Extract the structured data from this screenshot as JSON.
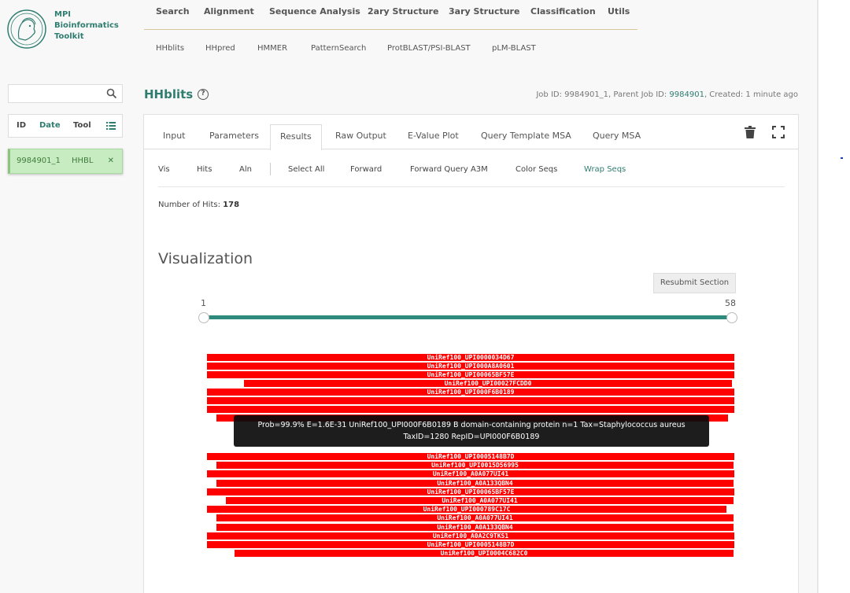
{
  "brand": {
    "line1": "MPI",
    "line2": "Bioinformatics",
    "line3": "Toolkit"
  },
  "topnav": [
    "Search",
    "Alignment",
    "Sequence Analysis",
    "2ary Structure",
    "3ary Structure",
    "Classification",
    "Utils"
  ],
  "subnav": [
    "HHblits",
    "HHpred",
    "HMMER",
    "PatternSearch",
    "ProtBLAST/PSI-BLAST",
    "pLM-BLAST"
  ],
  "sidebar": {
    "search_placeholder": "",
    "headers": {
      "id": "ID",
      "date": "Date",
      "tool": "Tool"
    },
    "job": {
      "id": "9984901_1",
      "tool": "HHBL"
    }
  },
  "page": {
    "title": "HHblits",
    "job_label": "Job ID: 9984901_1,  Parent Job ID: ",
    "parent_id": "9984901",
    "created": ",  Created: 1 minute ago"
  },
  "tabs": [
    "Input",
    "Parameters",
    "Results",
    "Raw Output",
    "E-Value Plot",
    "Query Template MSA",
    "Query MSA"
  ],
  "toolbar": [
    "Vis",
    "Hits",
    "Aln",
    "Select All",
    "Forward",
    "Forward Query A3M",
    "Color Seqs",
    "Wrap Seqs"
  ],
  "hits": {
    "label": "Number of Hits:",
    "count": "178"
  },
  "visualization": {
    "title": "Visualization",
    "resubmit": "Resubmit Section",
    "range_min": "1",
    "range_max": "58"
  },
  "bars": [
    "UniRef100_UPI0000034D67",
    "UniRef100_UPI000A8A0601",
    "UniRef100_UPI00065BF57E",
    "UniRef100_UPI00027FCDD0",
    "UniRef100_UPI000F6B0189",
    "",
    "",
    "",
    "UniRef100_UPI0005148B7D",
    "UniRef100_UPI0015D56995",
    "UniRef100_A0A077UI41",
    "UniRef100_A0A133QBN4",
    "UniRef100_UPI00065BF57E",
    "UniRef100_A0A077UI41",
    "UniRef100_UPI000789C17C",
    "UniRef100_A0A077UI41",
    "UniRef100_A0A133QBN4",
    "UniRef100_A0A2C9TKS1",
    "UniRef100_UPI0005148B7D",
    "UniRef100_UPI0004C682C0"
  ],
  "tooltip": {
    "line1": "Prob=99.9% E=1.6E-31 UniRef100_UPI000F6B0189 B domain-containing protein n=1 Tax=Staphylococcus aureus",
    "line2": "TaxID=1280 RepID=UPI000F6B0189"
  }
}
